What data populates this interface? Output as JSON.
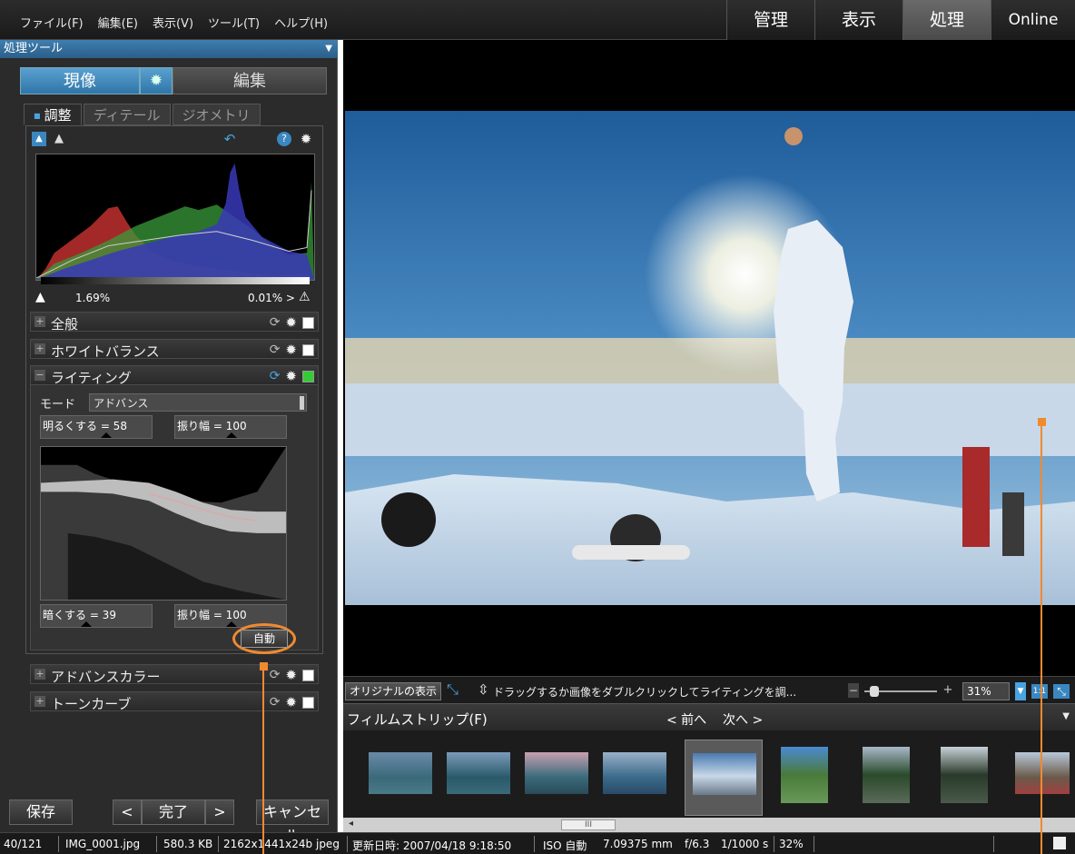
{
  "menu": [
    "ファイル(F)",
    "編集(E)",
    "表示(V)",
    "ツール(T)",
    "ヘルプ(H)"
  ],
  "modes": [
    {
      "label": "管理",
      "active": false
    },
    {
      "label": "表示",
      "active": false
    },
    {
      "label": "処理",
      "active": true
    },
    {
      "label": "Online",
      "active": false
    }
  ],
  "panel": {
    "title": "処理ツール",
    "develop": "現像",
    "edit": "編集",
    "tabs": [
      "調整",
      "ディテール",
      "ジオメトリ"
    ],
    "clip_low": "1.69%",
    "clip_high": "0.01% >"
  },
  "sections": {
    "general": "全般",
    "white_balance": "ホワイトバランス",
    "lighting": "ライティング",
    "advanced_color": "アドバンスカラー",
    "tone_curve": "トーンカーブ"
  },
  "lighting": {
    "mode_label": "モード",
    "mode_value": "アドバンス",
    "brighten": "明るくする = 58",
    "amp1": "振り幅 = 100",
    "darken": "暗くする = 39",
    "amp2": "振り幅 = 100",
    "auto": "自動",
    "brighten_level": 58,
    "darken_level": 39
  },
  "footer": {
    "save": "保存",
    "prev": "<",
    "done": "完了",
    "next": ">",
    "cancel": "キャンセル"
  },
  "viewer": {
    "original_btn": "オリジナルの表示",
    "hint": "ドラッグするか画像をダブルクリックしてライティングを調...",
    "zoom": "31%",
    "fit_1": "1:1"
  },
  "filmstrip": {
    "title": "フィルムストリップ(F)",
    "prev": "< 前へ",
    "next": "次へ >",
    "scroll_thumb": "III"
  },
  "status": {
    "count": "40/121",
    "file": "IMG_0001.jpg",
    "size": "580.3 KB",
    "dims": "2162x1441x24b jpeg",
    "modified": "更新日時: 2007/04/18 9:18:50",
    "iso": "ISO 自動",
    "focal": "7.09375 mm",
    "aperture": "f/6.3",
    "shutter": "1/1000 s",
    "zoom": "32%"
  },
  "colors": {
    "accent": "#f08a30",
    "blue": "#3a87c0"
  }
}
